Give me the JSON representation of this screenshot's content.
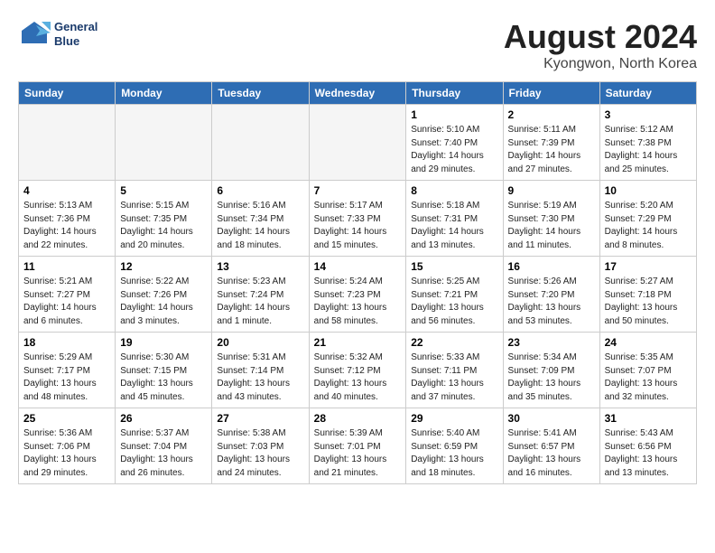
{
  "header": {
    "logo_line1": "General",
    "logo_line2": "Blue",
    "month": "August 2024",
    "location": "Kyongwon, North Korea"
  },
  "weekdays": [
    "Sunday",
    "Monday",
    "Tuesday",
    "Wednesday",
    "Thursday",
    "Friday",
    "Saturday"
  ],
  "weeks": [
    [
      {
        "day": "",
        "info": ""
      },
      {
        "day": "",
        "info": ""
      },
      {
        "day": "",
        "info": ""
      },
      {
        "day": "",
        "info": ""
      },
      {
        "day": "1",
        "info": "Sunrise: 5:10 AM\nSunset: 7:40 PM\nDaylight: 14 hours\nand 29 minutes."
      },
      {
        "day": "2",
        "info": "Sunrise: 5:11 AM\nSunset: 7:39 PM\nDaylight: 14 hours\nand 27 minutes."
      },
      {
        "day": "3",
        "info": "Sunrise: 5:12 AM\nSunset: 7:38 PM\nDaylight: 14 hours\nand 25 minutes."
      }
    ],
    [
      {
        "day": "4",
        "info": "Sunrise: 5:13 AM\nSunset: 7:36 PM\nDaylight: 14 hours\nand 22 minutes."
      },
      {
        "day": "5",
        "info": "Sunrise: 5:15 AM\nSunset: 7:35 PM\nDaylight: 14 hours\nand 20 minutes."
      },
      {
        "day": "6",
        "info": "Sunrise: 5:16 AM\nSunset: 7:34 PM\nDaylight: 14 hours\nand 18 minutes."
      },
      {
        "day": "7",
        "info": "Sunrise: 5:17 AM\nSunset: 7:33 PM\nDaylight: 14 hours\nand 15 minutes."
      },
      {
        "day": "8",
        "info": "Sunrise: 5:18 AM\nSunset: 7:31 PM\nDaylight: 14 hours\nand 13 minutes."
      },
      {
        "day": "9",
        "info": "Sunrise: 5:19 AM\nSunset: 7:30 PM\nDaylight: 14 hours\nand 11 minutes."
      },
      {
        "day": "10",
        "info": "Sunrise: 5:20 AM\nSunset: 7:29 PM\nDaylight: 14 hours\nand 8 minutes."
      }
    ],
    [
      {
        "day": "11",
        "info": "Sunrise: 5:21 AM\nSunset: 7:27 PM\nDaylight: 14 hours\nand 6 minutes."
      },
      {
        "day": "12",
        "info": "Sunrise: 5:22 AM\nSunset: 7:26 PM\nDaylight: 14 hours\nand 3 minutes."
      },
      {
        "day": "13",
        "info": "Sunrise: 5:23 AM\nSunset: 7:24 PM\nDaylight: 14 hours\nand 1 minute."
      },
      {
        "day": "14",
        "info": "Sunrise: 5:24 AM\nSunset: 7:23 PM\nDaylight: 13 hours\nand 58 minutes."
      },
      {
        "day": "15",
        "info": "Sunrise: 5:25 AM\nSunset: 7:21 PM\nDaylight: 13 hours\nand 56 minutes."
      },
      {
        "day": "16",
        "info": "Sunrise: 5:26 AM\nSunset: 7:20 PM\nDaylight: 13 hours\nand 53 minutes."
      },
      {
        "day": "17",
        "info": "Sunrise: 5:27 AM\nSunset: 7:18 PM\nDaylight: 13 hours\nand 50 minutes."
      }
    ],
    [
      {
        "day": "18",
        "info": "Sunrise: 5:29 AM\nSunset: 7:17 PM\nDaylight: 13 hours\nand 48 minutes."
      },
      {
        "day": "19",
        "info": "Sunrise: 5:30 AM\nSunset: 7:15 PM\nDaylight: 13 hours\nand 45 minutes."
      },
      {
        "day": "20",
        "info": "Sunrise: 5:31 AM\nSunset: 7:14 PM\nDaylight: 13 hours\nand 43 minutes."
      },
      {
        "day": "21",
        "info": "Sunrise: 5:32 AM\nSunset: 7:12 PM\nDaylight: 13 hours\nand 40 minutes."
      },
      {
        "day": "22",
        "info": "Sunrise: 5:33 AM\nSunset: 7:11 PM\nDaylight: 13 hours\nand 37 minutes."
      },
      {
        "day": "23",
        "info": "Sunrise: 5:34 AM\nSunset: 7:09 PM\nDaylight: 13 hours\nand 35 minutes."
      },
      {
        "day": "24",
        "info": "Sunrise: 5:35 AM\nSunset: 7:07 PM\nDaylight: 13 hours\nand 32 minutes."
      }
    ],
    [
      {
        "day": "25",
        "info": "Sunrise: 5:36 AM\nSunset: 7:06 PM\nDaylight: 13 hours\nand 29 minutes."
      },
      {
        "day": "26",
        "info": "Sunrise: 5:37 AM\nSunset: 7:04 PM\nDaylight: 13 hours\nand 26 minutes."
      },
      {
        "day": "27",
        "info": "Sunrise: 5:38 AM\nSunset: 7:03 PM\nDaylight: 13 hours\nand 24 minutes."
      },
      {
        "day": "28",
        "info": "Sunrise: 5:39 AM\nSunset: 7:01 PM\nDaylight: 13 hours\nand 21 minutes."
      },
      {
        "day": "29",
        "info": "Sunrise: 5:40 AM\nSunset: 6:59 PM\nDaylight: 13 hours\nand 18 minutes."
      },
      {
        "day": "30",
        "info": "Sunrise: 5:41 AM\nSunset: 6:57 PM\nDaylight: 13 hours\nand 16 minutes."
      },
      {
        "day": "31",
        "info": "Sunrise: 5:43 AM\nSunset: 6:56 PM\nDaylight: 13 hours\nand 13 minutes."
      }
    ]
  ]
}
